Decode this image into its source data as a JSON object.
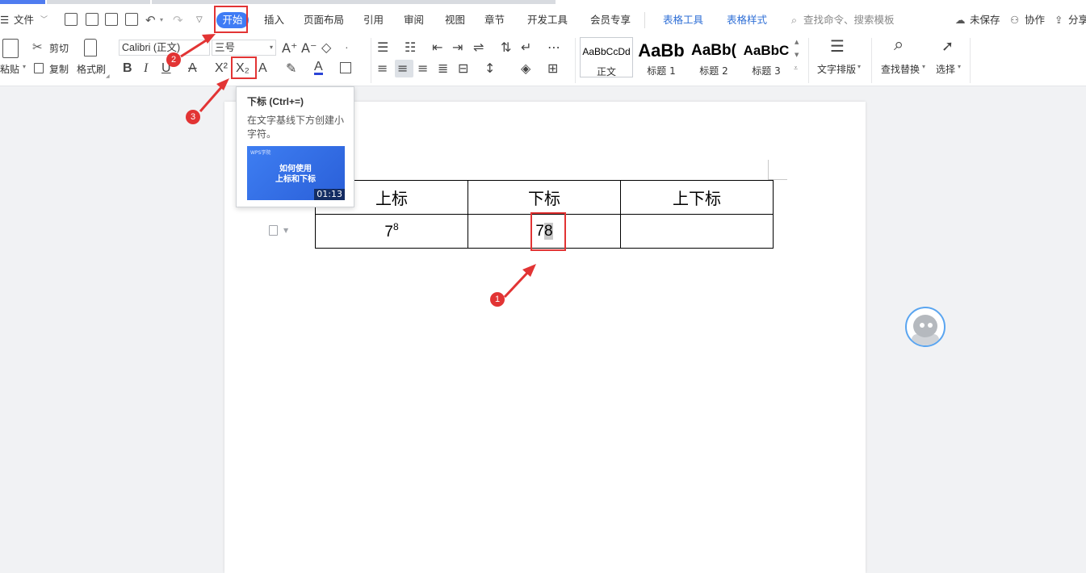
{
  "menubar": {
    "file_label": "文件",
    "tabs": [
      "开始",
      "插入",
      "页面布局",
      "引用",
      "审阅",
      "视图",
      "章节",
      "开发工具",
      "会员专享",
      "表格工具",
      "表格样式"
    ],
    "search_placeholder": "查找命令、搜索模板",
    "unsaved_label": "未保存",
    "collab_label": "协作",
    "share_label": "分享"
  },
  "ribbon": {
    "paste_label": "粘贴",
    "cut_label": "剪切",
    "copy_label": "复制",
    "format_painter_label": "格式刷",
    "font_name": "Calibri (正文)",
    "font_size": "三号",
    "styles": [
      {
        "preview": "AaBbCcDd",
        "name": "正文"
      },
      {
        "preview": "AaBb",
        "name": "标题 1"
      },
      {
        "preview": "AaBb(",
        "name": "标题 2"
      },
      {
        "preview": "AaBbC",
        "name": "标题 3"
      }
    ],
    "text_layout_label": "文字排版",
    "find_replace_label": "查找替换",
    "select_label": "选择"
  },
  "tooltip": {
    "title": "下标 (Ctrl+=)",
    "description": "在文字基线下方创建小字符。",
    "video_caption_line1": "如何使用",
    "video_caption_line2": "上标和下标",
    "video_logo": "WPS学院",
    "video_duration": "01:13"
  },
  "document": {
    "table": {
      "headers": [
        "上标",
        "下标",
        "上下标"
      ],
      "row": {
        "superscript_base": "7",
        "superscript_exp": "8",
        "subscript_base": "7",
        "subscript_selected": "8",
        "combined": ""
      }
    }
  },
  "annotations": {
    "step1": "1",
    "step2": "2",
    "step3": "3",
    "color": "#e23434"
  },
  "colors": {
    "accent": "#3f7cf5",
    "table_tools": "#2f6fd6"
  }
}
